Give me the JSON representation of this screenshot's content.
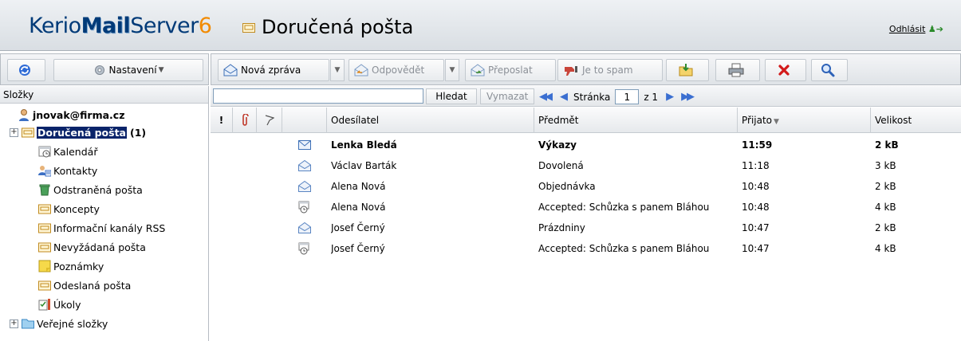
{
  "app": {
    "logo_part1": "Kerio",
    "logo_part2": "Mail",
    "logo_part3": "Server",
    "logo_part4": "6",
    "folder_title": "Doručená pošta",
    "logout_label": "Odhlásit"
  },
  "toolbar_left": {
    "settings_label": "Nastavení"
  },
  "toolbar": {
    "new_message": "Nová zpráva",
    "reply": "Odpovědět",
    "forward": "Přeposlat",
    "spam": "Je to spam"
  },
  "folders": {
    "header": "Složky",
    "account": "jnovak@firma.cz",
    "items": [
      {
        "label": "Doručená pošta",
        "count": "(1)"
      },
      {
        "label": "Kalendář"
      },
      {
        "label": "Kontakty"
      },
      {
        "label": "Odstraněná pošta"
      },
      {
        "label": "Koncepty"
      },
      {
        "label": "Informační kanály RSS"
      },
      {
        "label": "Nevyžádaná pošta"
      },
      {
        "label": "Poznámky"
      },
      {
        "label": "Odeslaná pošta"
      },
      {
        "label": "Úkoly"
      },
      {
        "label": "Veřejné složky"
      }
    ]
  },
  "search": {
    "value": "",
    "search_button": "Hledat",
    "clear_button": "Vymazat",
    "page_label": "Stránka",
    "page_value": "1",
    "page_of": "z 1"
  },
  "columns": {
    "flag": "!",
    "sender": "Odesílatel",
    "subject": "Předmět",
    "received": "Přijato",
    "size": "Velikost"
  },
  "messages": [
    {
      "icon": "envelope-closed-icon",
      "sender": "Lenka Bledá",
      "subject": "Výkazy",
      "received": "11:59",
      "size": "2 kB",
      "unread": true
    },
    {
      "icon": "envelope-open-icon",
      "sender": "Václav Barták",
      "subject": "Dovolená",
      "received": "11:18",
      "size": "3 kB",
      "unread": false
    },
    {
      "icon": "envelope-open-icon",
      "sender": "Alena Nová",
      "subject": "Objednávka",
      "received": "10:48",
      "size": "2 kB",
      "unread": false
    },
    {
      "icon": "calendar-invite-icon",
      "sender": "Alena Nová",
      "subject": "Accepted: Schůzka s panem Bláhou",
      "received": "10:48",
      "size": "4 kB",
      "unread": false
    },
    {
      "icon": "envelope-open-icon",
      "sender": "Josef Černý",
      "subject": "Prázdniny",
      "received": "10:47",
      "size": "2 kB",
      "unread": false
    },
    {
      "icon": "calendar-invite-icon",
      "sender": "Josef Černý",
      "subject": "Accepted: Schůzka s panem Bláhou",
      "received": "10:47",
      "size": "4 kB",
      "unread": false
    }
  ],
  "colors": {
    "selection": "#0a246a",
    "logo_blue": "#003a78",
    "logo_orange": "#f28a00"
  }
}
